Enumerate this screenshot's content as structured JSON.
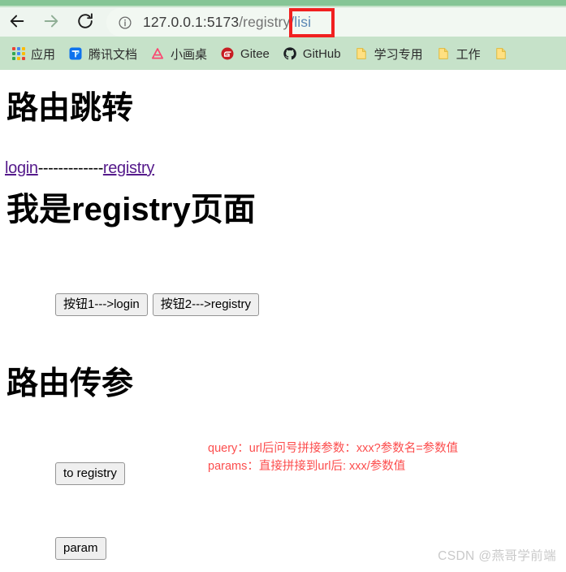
{
  "browser": {
    "nav": {
      "back_label": "Back",
      "forward_label": "Forward",
      "reload_label": "Reload"
    },
    "omnibox": {
      "security_icon": "info-circle-icon",
      "url_full": "127.0.0.1:5173/registry/lisi",
      "url_host": "127.0.0.1:5173",
      "url_path": "/registry",
      "url_tail": "/lisi",
      "highlight_target": "/lisi"
    },
    "bookmarks": [
      {
        "label": "应用",
        "icon": "apps-grid-icon"
      },
      {
        "label": "腾讯文档",
        "icon": "tencent-docs-icon"
      },
      {
        "label": "小画桌",
        "icon": "xiaohuazhuo-icon"
      },
      {
        "label": "Gitee",
        "icon": "gitee-icon"
      },
      {
        "label": "GitHub",
        "icon": "github-icon"
      },
      {
        "label": "学习专用",
        "icon": "folder-icon"
      },
      {
        "label": "工作",
        "icon": "folder-icon"
      },
      {
        "label": "",
        "icon": "folder-icon"
      }
    ],
    "colors": {
      "chrome_top": "#86c596",
      "toolbar": "#c6e2c9",
      "omnibox": "#f2f8f2",
      "highlight_box": "#f12020"
    }
  },
  "page": {
    "title_route_jump": "路由跳转",
    "link_login": "login",
    "link_separator": "-------------",
    "link_registry": "registry",
    "heading_registry_page": "我是registry页面",
    "buttons": {
      "nav_login": "按钮1--->login",
      "nav_registry": "按钮2--->registry",
      "to_registry": "to registry",
      "param": "param"
    },
    "title_route_params": "路由传参",
    "params_note_line1": "query：url后问号拼接参数：xxx?参数名=参数值",
    "params_note_line2": "params：直接拼接到url后: xxx/参数值",
    "note_color": "#fc4d4d",
    "link_color": "#551a8b",
    "watermark": "CSDN @燕哥学前端"
  }
}
